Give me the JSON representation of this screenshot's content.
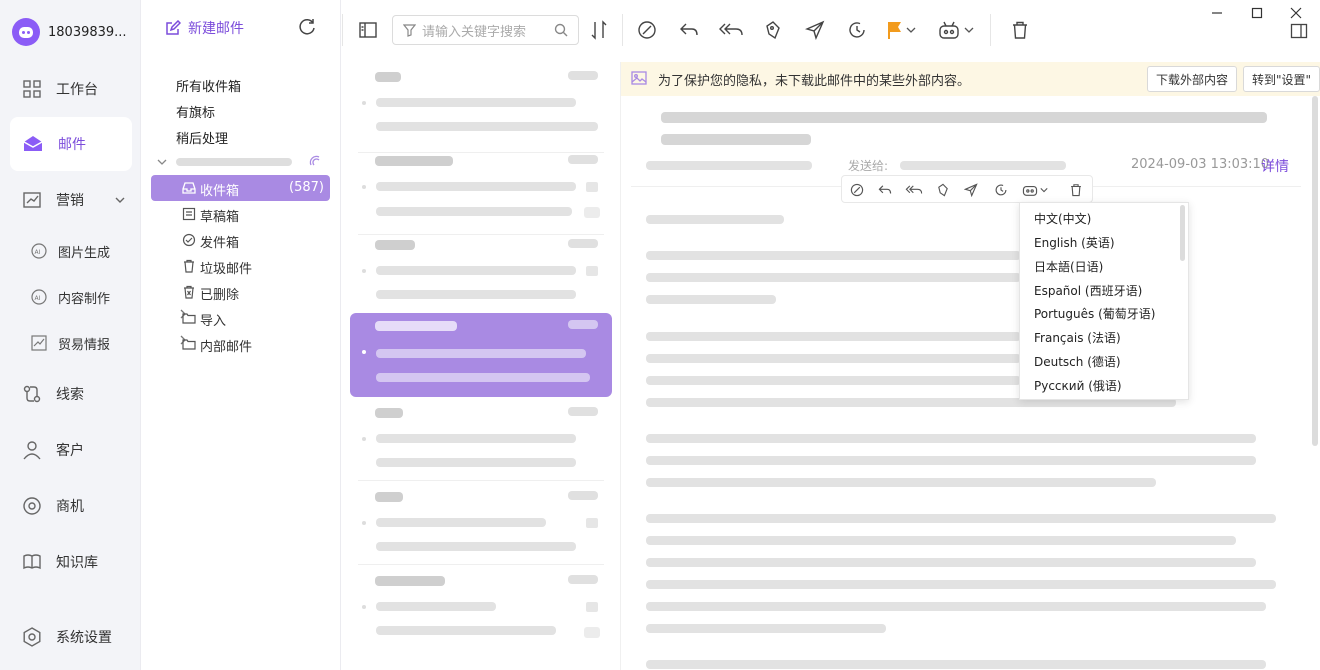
{
  "account": {
    "name": "18039839..."
  },
  "nav": {
    "workbench": "工作台",
    "mail": "邮件",
    "marketing": "营销",
    "image_gen": "图片生成",
    "content": "内容制作",
    "trade": "贸易情报",
    "leads": "线索",
    "customers": "客户",
    "business": "商机",
    "knowledge": "知识库",
    "settings": "系统设置"
  },
  "folders": {
    "new_mail": "新建邮件",
    "all_inbox": "所有收件箱",
    "flagged": "有旗标",
    "later": "稍后处理",
    "inbox": "收件箱",
    "inbox_count": "(587)",
    "drafts": "草稿箱",
    "sent": "发件箱",
    "junk": "垃圾邮件",
    "deleted": "已删除",
    "import": "导入",
    "internal": "内部邮件"
  },
  "toolbar": {
    "search_placeholder": "请输入关键字搜索"
  },
  "reader": {
    "privacy_text": "为了保护您的隐私，未下载此邮件中的某些外部内容。",
    "download_btn": "下载外部内容",
    "settings_btn": "转到\"设置\"",
    "date": "2024-09-03 13:03:10",
    "detail": "详情",
    "sent_to_label": "发送给:"
  },
  "languages": [
    "中文(中文)",
    "English (英语)",
    "日本語(日语)",
    "Español (西班牙语)",
    "Português (葡萄牙语)",
    "Français (法语)",
    "Deutsch (德语)",
    "Русский (俄语)"
  ],
  "colors": {
    "accent": "#7c4ddb",
    "selected": "#a98ae3",
    "flag": "#f29b1d"
  }
}
